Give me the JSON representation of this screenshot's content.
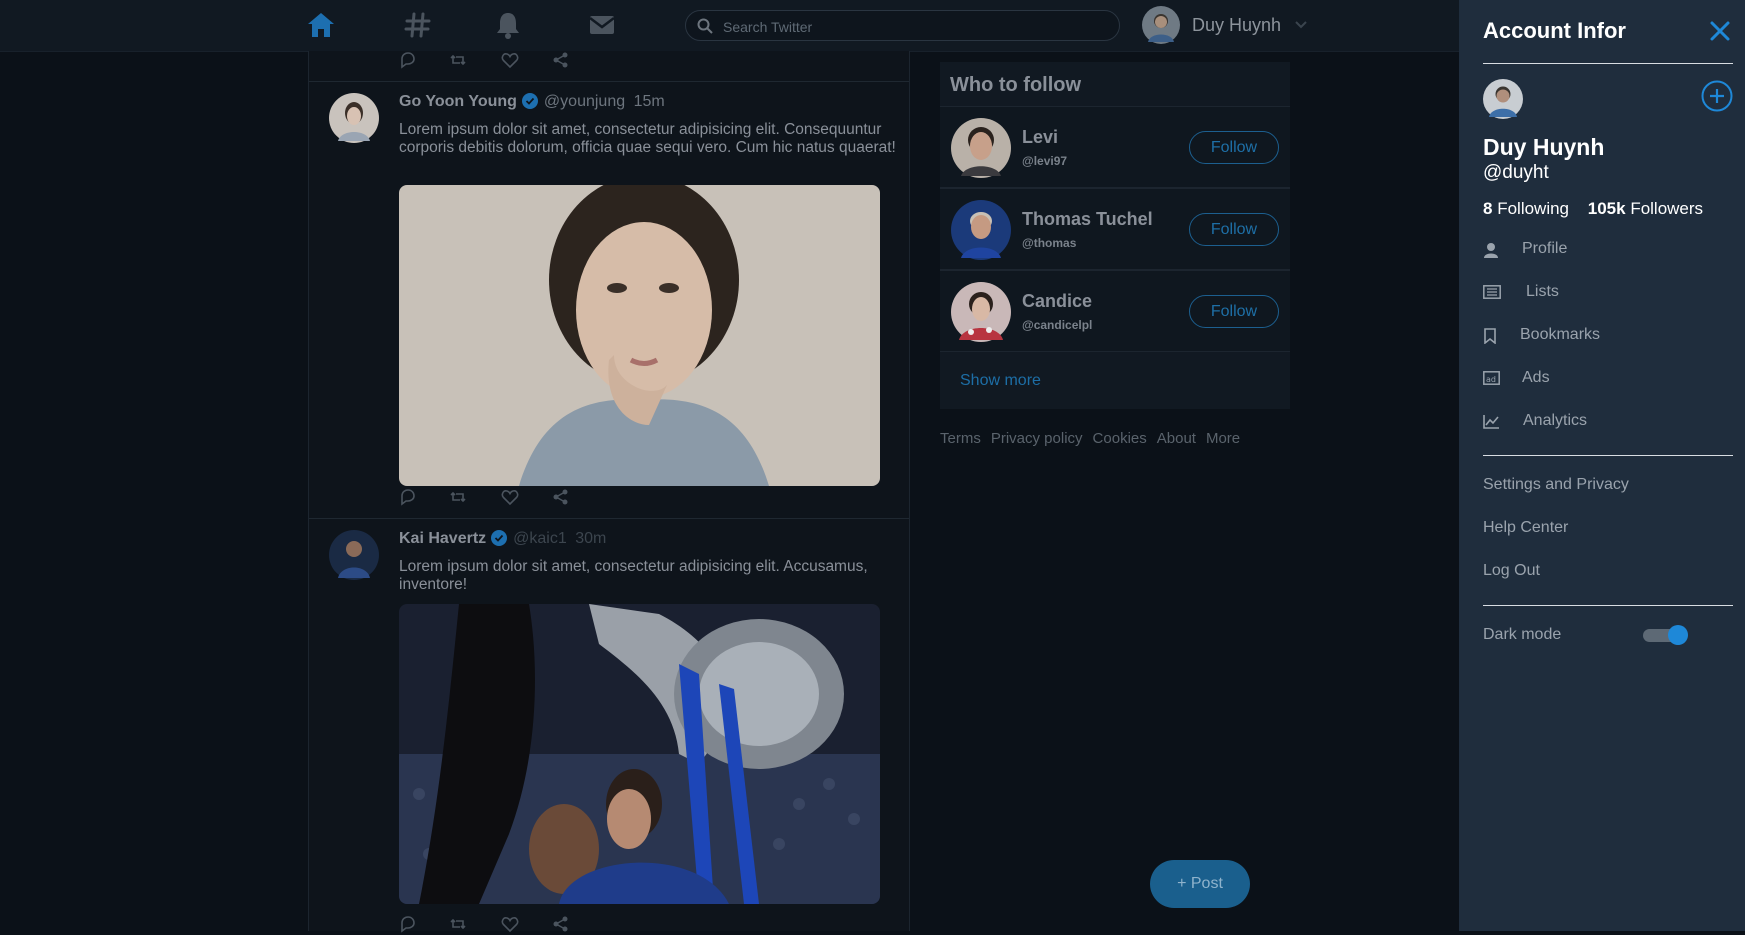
{
  "nav": {
    "search_placeholder": "Search Twitter",
    "user_name": "Duy Huynh",
    "icons": [
      "home-icon",
      "hashtag-icon",
      "bell-icon",
      "mail-icon"
    ],
    "active_color": "#1d6fb0"
  },
  "feed": {
    "tweets": [
      {
        "name": "Go Yoon Young",
        "handle": "@younjung",
        "time": "15m",
        "text": "Lorem ipsum dolor sit amet, consectetur adipisicing elit. Consequuntur corporis debitis dolorum, officia quae sequi vero. Cum hic natus quaerat!"
      },
      {
        "name": "Kai Havertz",
        "handle": "@kaic1",
        "time": "30m",
        "text": "Lorem ipsum dolor sit amet, consectetur adipisicing elit. Accusamus, inventore!"
      }
    ]
  },
  "who_to_follow": {
    "title": "Who to follow",
    "people": [
      {
        "name": "Levi",
        "handle": "@levi97",
        "button": "Follow"
      },
      {
        "name": "Thomas Tuchel",
        "handle": "@thomas",
        "button": "Follow"
      },
      {
        "name": "Candice",
        "handle": "@candicelpl",
        "button": "Follow"
      }
    ],
    "show_more": "Show more"
  },
  "footer_links": [
    "Terms",
    "Privacy policy",
    "Cookies",
    "About",
    "More"
  ],
  "post_button": "+ Post",
  "account_panel": {
    "title": "Account Infor",
    "name": "Duy Huynh",
    "handle": "@duyht",
    "following_count": "8",
    "following_label": "Following",
    "followers_count": "105k",
    "followers_label": "Followers",
    "menu": [
      {
        "label": "Profile",
        "icon": "user-icon"
      },
      {
        "label": "Lists",
        "icon": "list-icon"
      },
      {
        "label": "Bookmarks",
        "icon": "bookmark-icon"
      },
      {
        "label": "Ads",
        "icon": "ads-icon"
      },
      {
        "label": "Analytics",
        "icon": "analytics-icon"
      }
    ],
    "settings": "Settings and Privacy",
    "help": "Help Center",
    "logout": "Log Out",
    "dark_mode_label": "Dark mode",
    "dark_mode_on": true,
    "accent_color": "#1e88d8"
  }
}
